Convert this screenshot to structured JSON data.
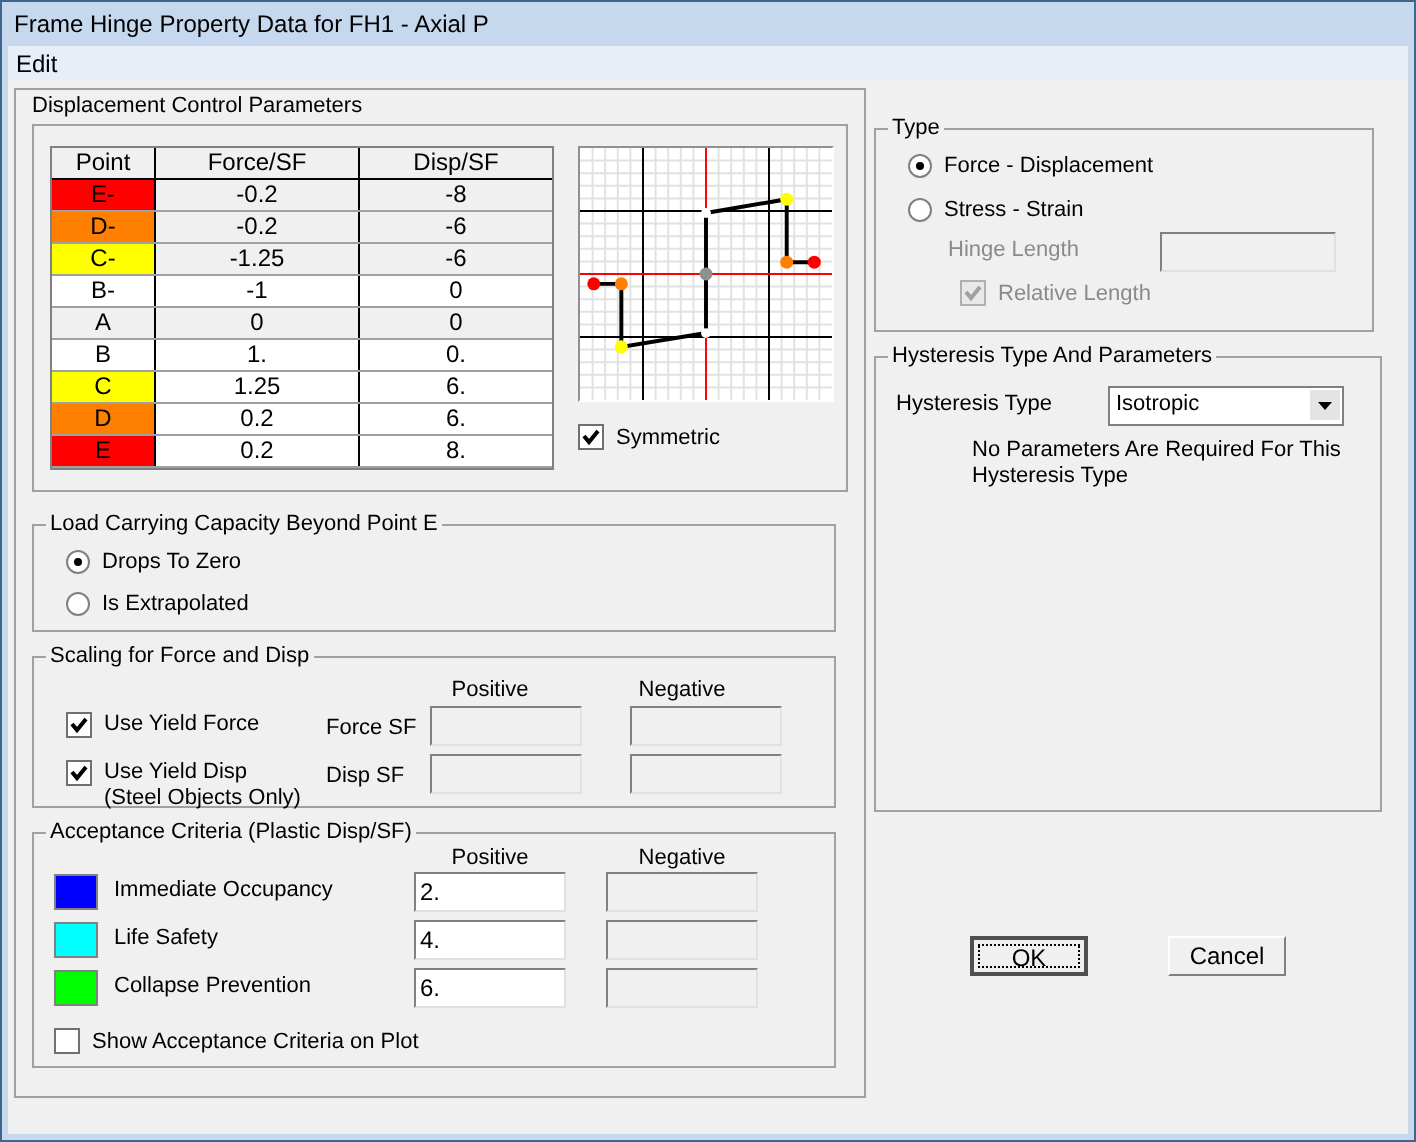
{
  "window": {
    "title": "Frame Hinge Property Data for FH1 - Axial P"
  },
  "menu": [
    "Edit"
  ],
  "displacement_control": {
    "title": "Displacement Control Parameters",
    "table": {
      "columns": [
        "Point",
        "Force/SF",
        "Disp/SF"
      ],
      "rows": [
        {
          "point": "E-",
          "force": "-0.2",
          "disp": "-8",
          "color": "#ff0000",
          "disabled": true
        },
        {
          "point": "D-",
          "force": "-0.2",
          "disp": "-6",
          "color": "#ff8000",
          "disabled": true
        },
        {
          "point": "C-",
          "force": "-1.25",
          "disp": "-6",
          "color": "#ffff00",
          "disabled": true
        },
        {
          "point": "B-",
          "force": "-1",
          "disp": "0",
          "color": "#ffffff",
          "disabled": false
        },
        {
          "point": "A",
          "force": "0",
          "disp": "0",
          "color": "#f0f0f0",
          "disabled": true
        },
        {
          "point": "B",
          "force": "1.",
          "disp": "0.",
          "color": "#ffffff",
          "disabled": false
        },
        {
          "point": "C",
          "force": "1.25",
          "disp": "6.",
          "color": "#ffff00",
          "disabled": false
        },
        {
          "point": "D",
          "force": "0.2",
          "disp": "6.",
          "color": "#ff8000",
          "disabled": false
        },
        {
          "point": "E",
          "force": "0.2",
          "disp": "8.",
          "color": "#ff0000",
          "disabled": false
        }
      ]
    },
    "symmetric": {
      "label": "Symmetric",
      "checked": true
    }
  },
  "load_capacity": {
    "title": "Load Carrying Capacity Beyond Point E",
    "options": [
      {
        "label": "Drops To Zero",
        "selected": true
      },
      {
        "label": "Is Extrapolated",
        "selected": false
      }
    ]
  },
  "scaling": {
    "title": "Scaling for Force and Disp",
    "columns": [
      "Positive",
      "Negative"
    ],
    "rows": [
      {
        "label": "Use Yield Force",
        "checked": true,
        "field_label": "Force SF"
      },
      {
        "label": "Use Yield Disp",
        "note": "(Steel Objects Only)",
        "checked": true,
        "field_label": "Disp SF"
      }
    ]
  },
  "acceptance": {
    "title": "Acceptance Criteria (Plastic Disp/SF)",
    "columns": [
      "Positive",
      "Negative"
    ],
    "rows": [
      {
        "label": "Immediate Occupancy",
        "color": "#0000ff",
        "positive": "2."
      },
      {
        "label": "Life Safety",
        "color": "#00ffff",
        "positive": "4."
      },
      {
        "label": "Collapse Prevention",
        "color": "#00ff00",
        "positive": "6."
      }
    ],
    "show_on_plot": {
      "label": "Show Acceptance Criteria on Plot",
      "checked": false
    }
  },
  "type": {
    "title": "Type",
    "options": [
      {
        "label": "Force - Displacement",
        "selected": true
      },
      {
        "label": "Stress - Strain",
        "selected": false
      }
    ],
    "hinge_length": {
      "label": "Hinge Length",
      "disabled": true
    },
    "relative_length": {
      "label": "Relative Length",
      "checked": true,
      "disabled": true
    }
  },
  "hysteresis": {
    "title": "Hysteresis Type And Parameters",
    "label": "Hysteresis Type",
    "value": "Isotropic",
    "message": "No Parameters Are Required For This Hysteresis Type"
  },
  "buttons": [
    {
      "label": "OK",
      "focused": true
    },
    {
      "label": "Cancel",
      "focused": false
    }
  ]
}
